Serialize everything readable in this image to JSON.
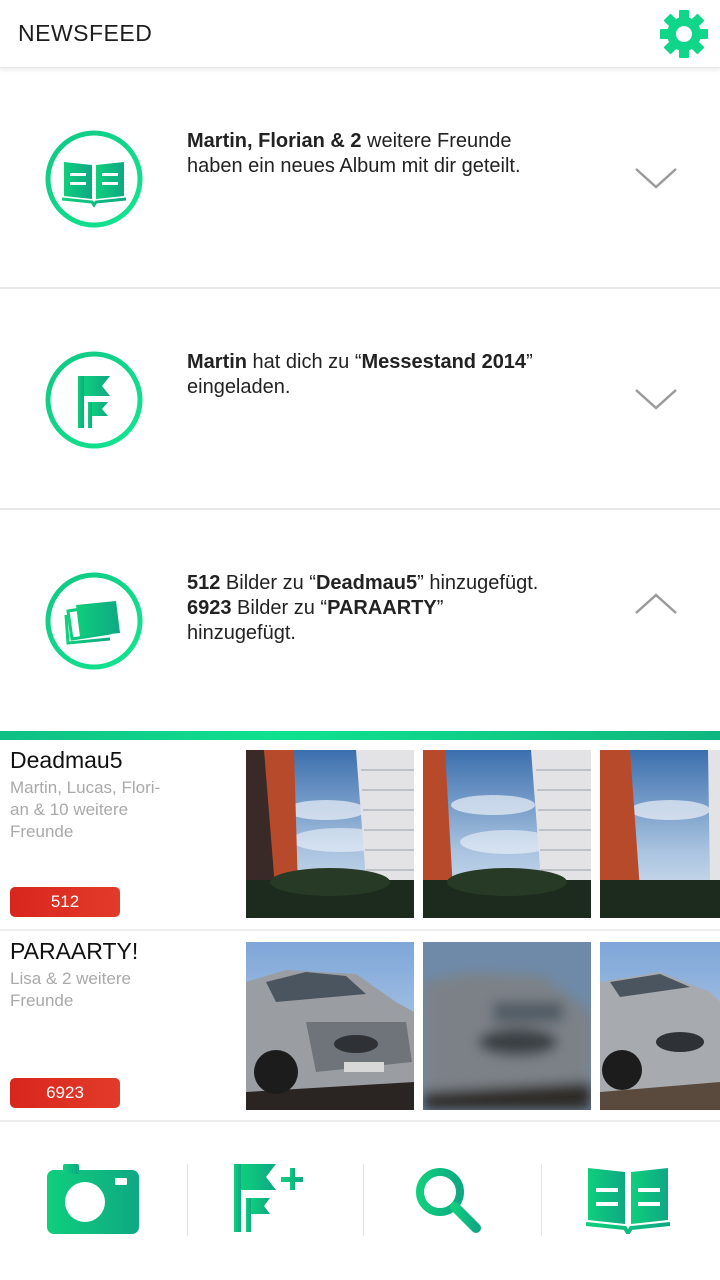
{
  "header": {
    "title": "NEWSFEED",
    "settings_icon": "gear-icon"
  },
  "colors": {
    "accent_green": "#0fd88a",
    "badge_red": "#dd2e22"
  },
  "notifications": [
    {
      "icon": "open-book-icon",
      "line1_bold": "Martin, Florian & 2",
      "line1_rest": " weitere Freunde",
      "line2": "haben ein neues Album mit dir geteilt.",
      "expanded": false
    },
    {
      "icon": "flags-icon",
      "line1_bold1": "Martin",
      "line1_mid": " hat dich zu “",
      "line1_bold2": "Messestand 2014",
      "line1_end": "”",
      "line2": "eingeladen.",
      "expanded": false
    },
    {
      "icon": "photos-icon",
      "l1_num": "512",
      "l1_mid": " Bilder zu  “",
      "l1_album": "Deadmau5",
      "l1_end": "” hinzugefügt.",
      "l2_num": "6923",
      "l2_mid": " Bilder zu “",
      "l2_album": "PARAARTY",
      "l2_end": "”",
      "l3": "hinzugefügt.",
      "expanded": true
    }
  ],
  "albums": [
    {
      "title": "Deadmau5",
      "sub1": "Martin, Lucas, Flori-",
      "sub2": "an & 10 weitere",
      "sub3": "Freunde",
      "count": "512"
    },
    {
      "title": "PARAARTY!",
      "sub1": "Lisa & 2 weitere",
      "sub2": "Freunde",
      "count": "6923"
    }
  ],
  "bottom_nav": [
    {
      "icon": "camera-icon"
    },
    {
      "icon": "add-flag-icon"
    },
    {
      "icon": "search-icon"
    },
    {
      "icon": "open-book-icon"
    }
  ]
}
